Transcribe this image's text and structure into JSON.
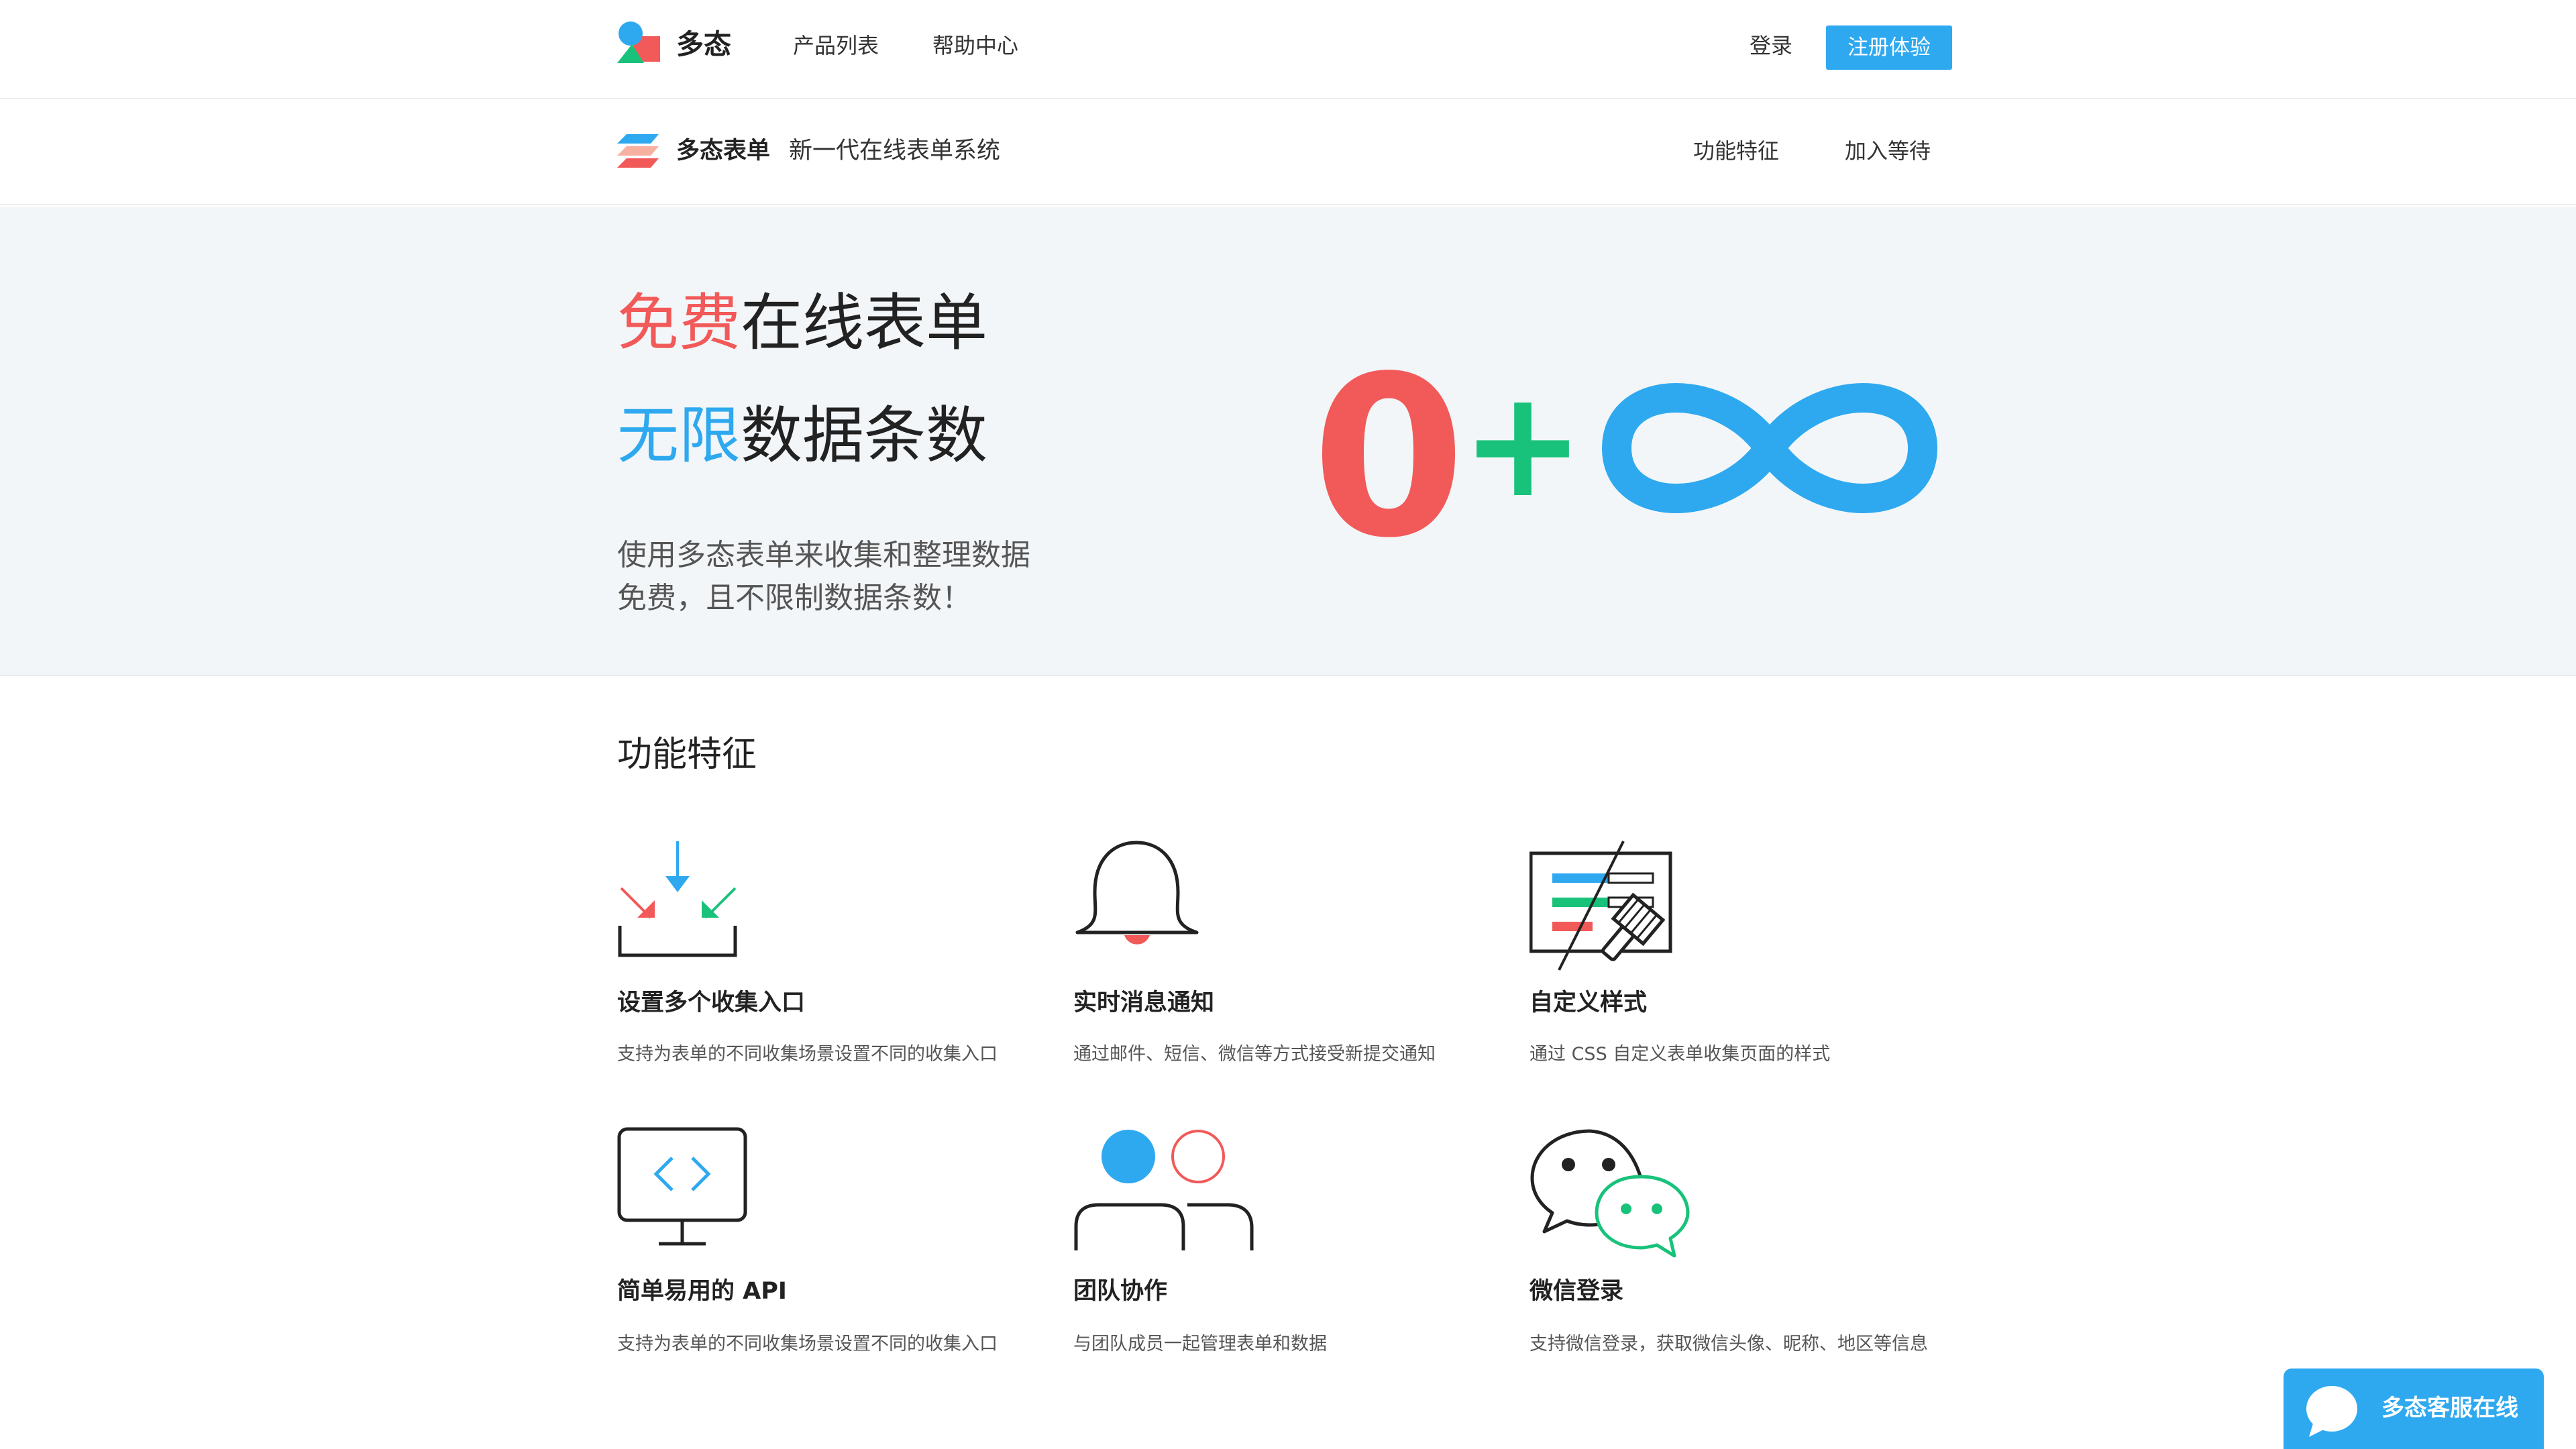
{
  "topnav": {
    "brand": "多态",
    "links": [
      "产品列表",
      "帮助中心"
    ],
    "login": "登录",
    "register": "注册体验"
  },
  "product": {
    "name": "多态表单",
    "tagline": "新一代在线表单系统",
    "nav": [
      "功能特征",
      "加入等待"
    ]
  },
  "hero": {
    "line1_highlight": "免费",
    "line1_rest": "在线表单",
    "line2_highlight": "无限",
    "line2_rest": "数据条数",
    "sub1": "使用多态表单来收集和整理数据",
    "sub2": "免费，且不限制数据条数！",
    "graphic": {
      "zero": "0",
      "plus": "+",
      "infinity_icon": "infinity-icon"
    }
  },
  "features": {
    "title": "功能特征",
    "items": [
      {
        "icon": "collect-entries-icon",
        "title": "设置多个收集入口",
        "desc": "支持为表单的不同收集场景设置不同的收集入口"
      },
      {
        "icon": "bell-icon",
        "title": "实时消息通知",
        "desc": "通过邮件、短信、微信等方式接受新提交通知"
      },
      {
        "icon": "custom-style-icon",
        "title": "自定义样式",
        "desc": "通过 CSS 自定义表单收集页面的样式"
      },
      {
        "icon": "monitor-code-icon",
        "title": "简单易用的 API",
        "desc": "支持为表单的不同收集场景设置不同的收集入口"
      },
      {
        "icon": "team-icon",
        "title": "团队协作",
        "desc": "与团队成员一起管理表单和数据"
      },
      {
        "icon": "wechat-icon",
        "title": "微信登录",
        "desc": "支持微信登录，获取微信头像、昵称、地区等信息"
      }
    ]
  },
  "chat": {
    "label": "多态客服在线"
  },
  "colors": {
    "accent_blue": "#2ea9f0",
    "accent_red": "#f25959",
    "accent_green": "#19c27a",
    "hero_bg": "#f3f6f8"
  }
}
